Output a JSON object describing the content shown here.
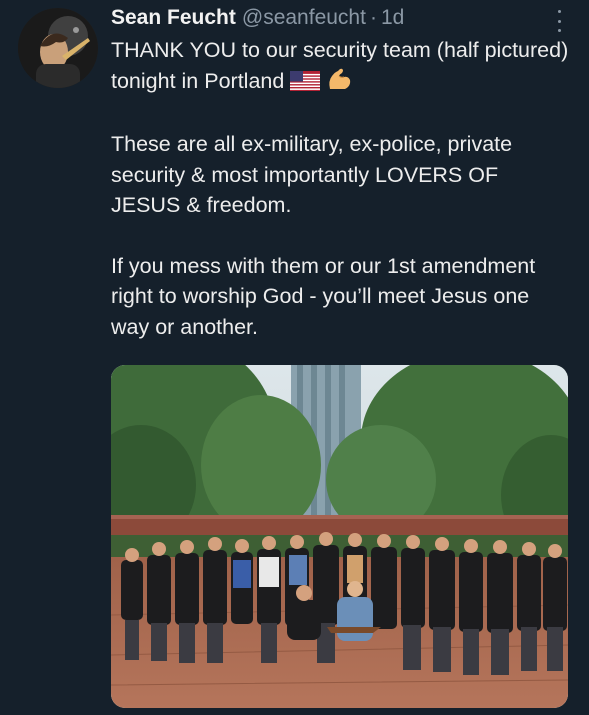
{
  "tweet": {
    "display_name": "Sean Feucht",
    "handle": "@seanfeucht",
    "separator": "·",
    "time": "1d",
    "paragraphs": [
      "THANK YOU to our security team (half pictured) tonight in Portland",
      "These are all ex-military, ex-police, private security & most importantly LOVERS OF JESUS & freedom.",
      "If you mess with them or our 1st amendment right to worship God - you’ll meet Jesus one way or another."
    ],
    "emojis": [
      "us-flag-icon",
      "flexed-biceps-icon"
    ],
    "media": {
      "description": "group-photo"
    }
  },
  "colors": {
    "background": "#15202b",
    "text": "#e7e9ea",
    "secondary_text": "#8b98a5"
  }
}
